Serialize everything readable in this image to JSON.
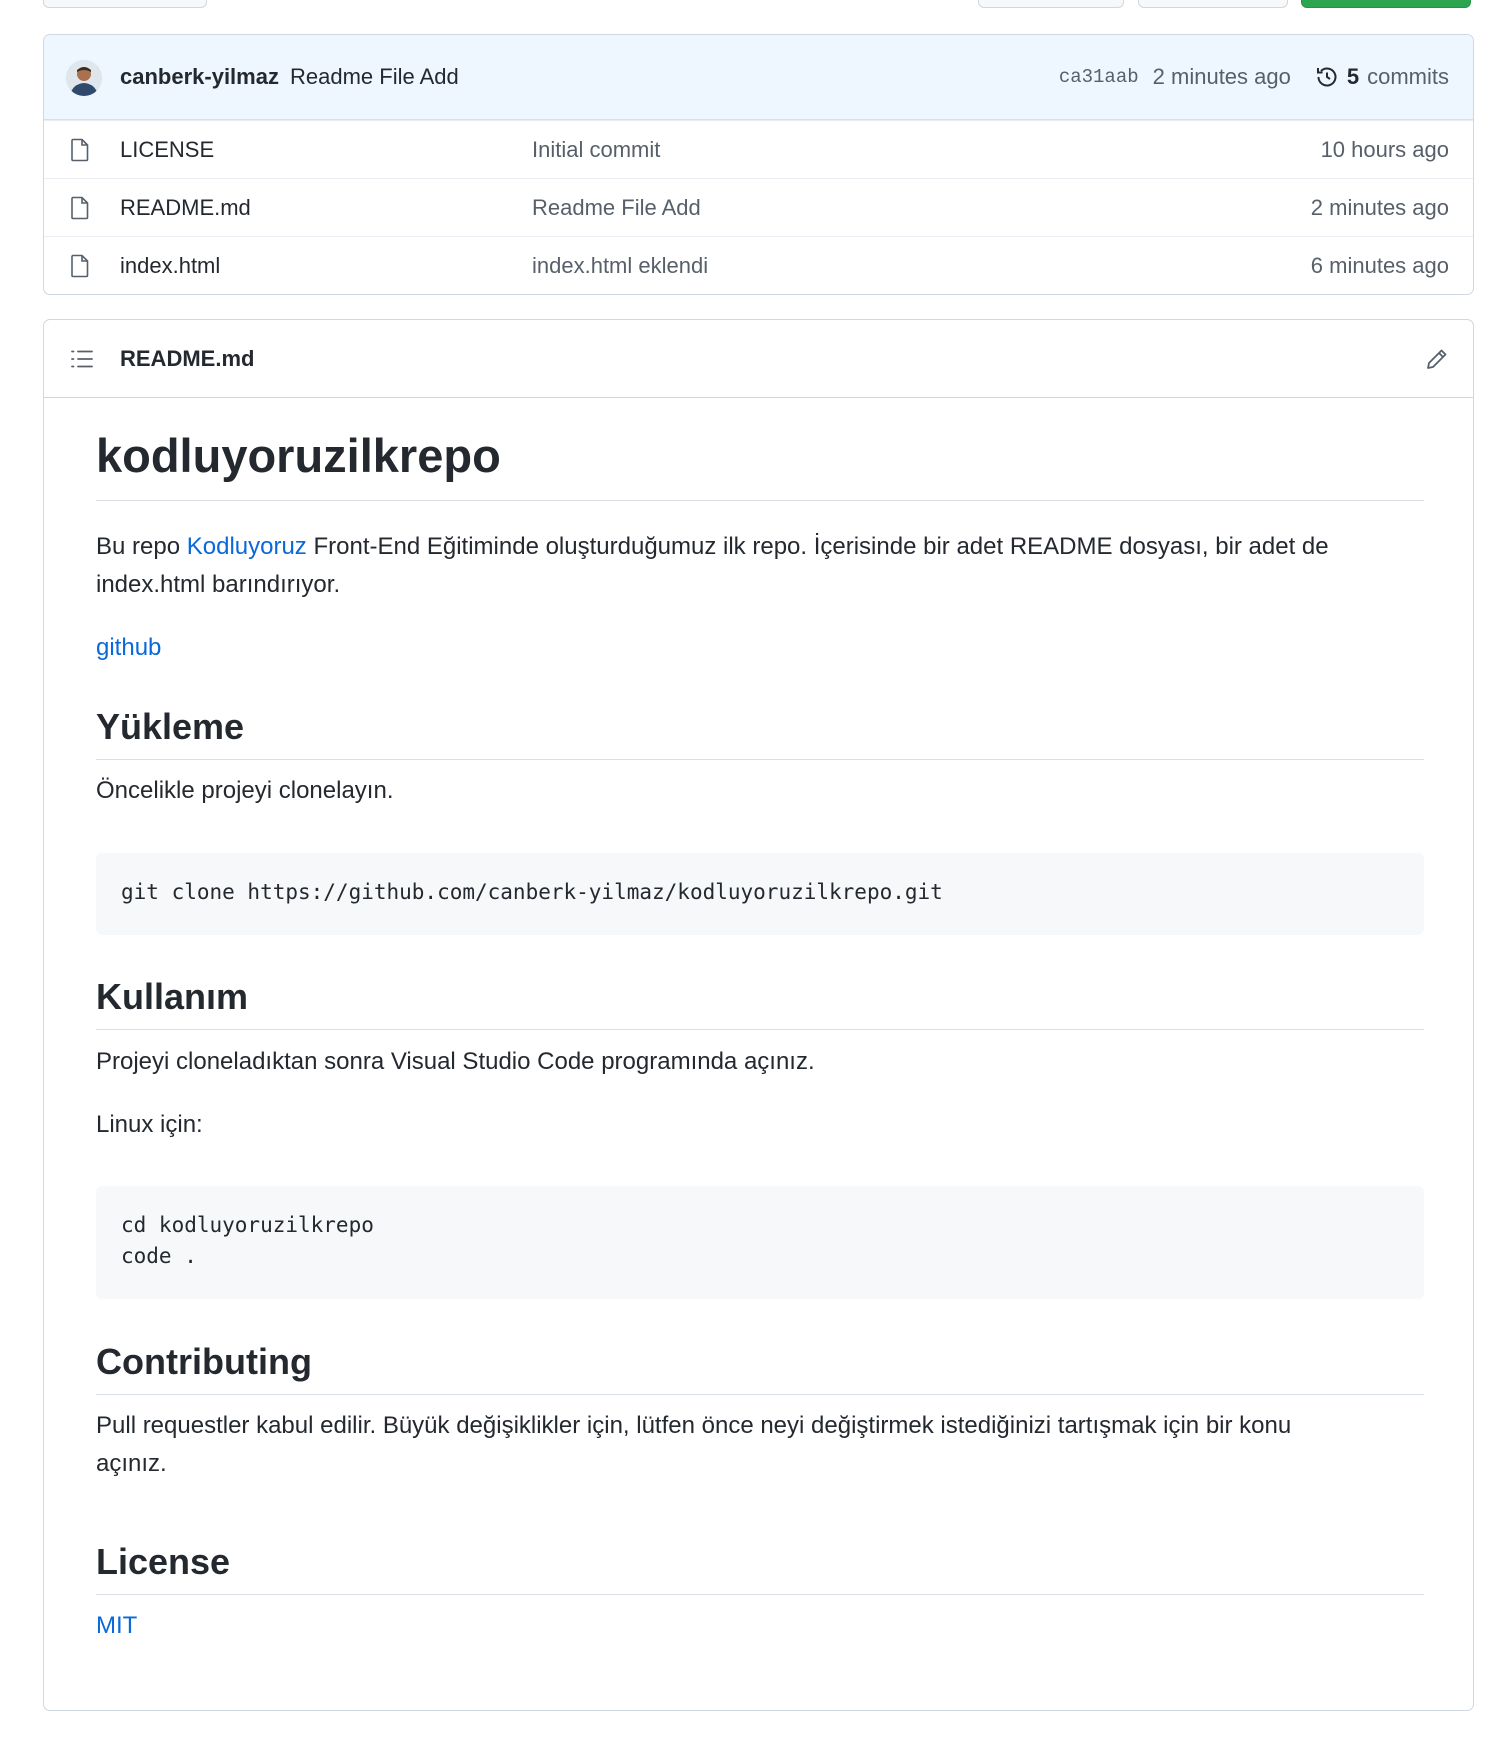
{
  "commit_bar": {
    "author": "canberk-yilmaz",
    "message": "Readme File Add",
    "sha": "ca31aab",
    "time": "2 minutes ago",
    "commits_count": "5",
    "commits_label": "commits"
  },
  "files": [
    {
      "name": "LICENSE",
      "commit": "Initial commit",
      "age": "10 hours ago"
    },
    {
      "name": "README.md",
      "commit": "Readme File Add",
      "age": "2 minutes ago"
    },
    {
      "name": "index.html",
      "commit": "index.html eklendi",
      "age": "6 minutes ago"
    }
  ],
  "readme": {
    "file_title": "README.md",
    "h1": "kodluyoruzilkrepo",
    "intro_before": "Bu repo ",
    "intro_link": "Kodluyoruz",
    "intro_line1_after": " Front-End Eğitiminde oluşturduğumuz ilk repo. İçerisinde bir adet README dosyası, bir adet de",
    "intro_line2": "index.html barındırıyor.",
    "github_link": "github",
    "h2_install": "Yükleme",
    "install_text": "Öncelikle projeyi clonelayın.",
    "install_code": "git clone https://github.com/canberk-yilmaz/kodluyoruzilkrepo.git",
    "h2_usage": "Kullanım",
    "usage_text": "Projeyi cloneladıktan sonra Visual Studio Code programında açınız.",
    "linux_text": "Linux için:",
    "usage_code_line1": "cd kodluyoruzilkrepo",
    "usage_code_line2": "code .",
    "h2_contributing": "Contributing",
    "contributing_line1": "Pull requestler kabul edilir. Büyük değişiklikler için, lütfen önce neyi değiştirmek istediğinizi tartışmak için bir konu",
    "contributing_line2": "açınız.",
    "h2_license": "License",
    "license_link": "MIT"
  }
}
